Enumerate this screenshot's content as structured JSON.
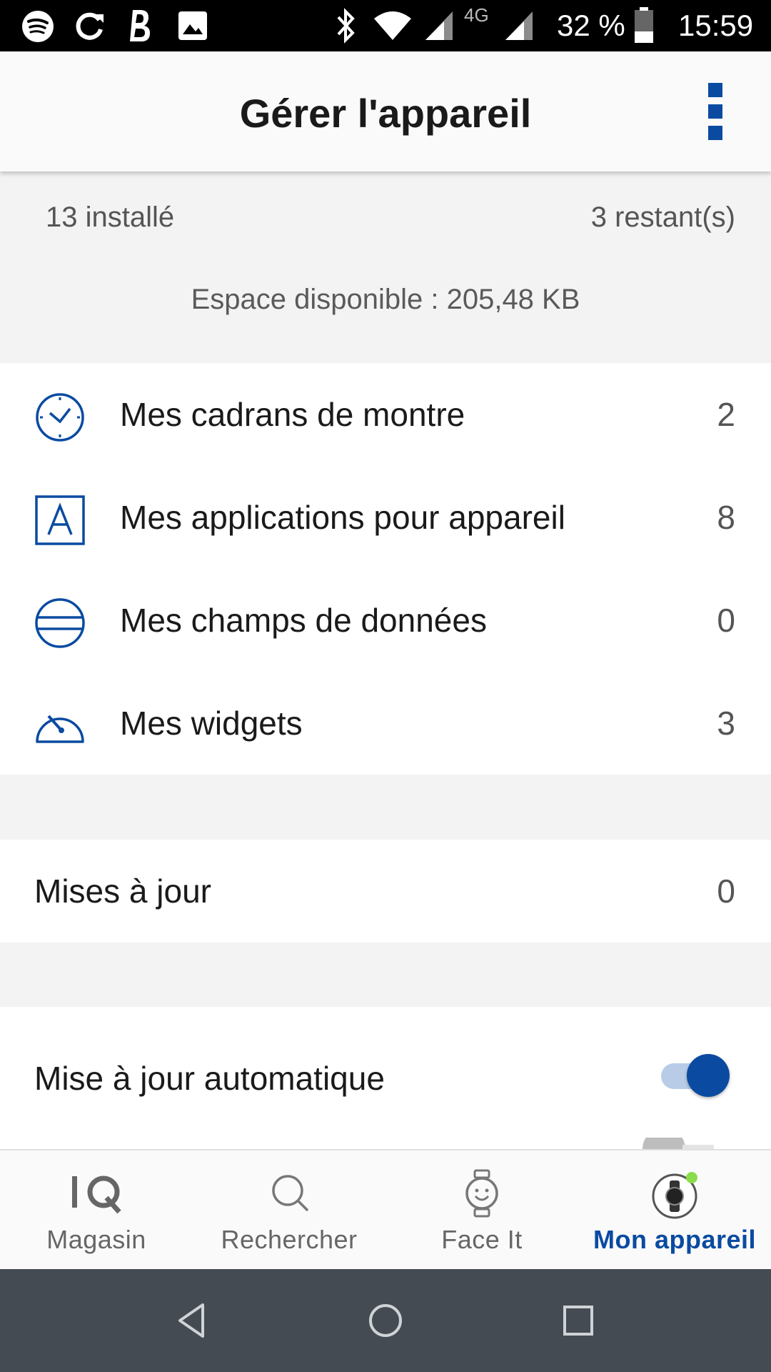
{
  "status_bar": {
    "battery_percent": "32 %",
    "time": "15:59",
    "network_label": "4G"
  },
  "header": {
    "title": "Gérer l'appareil"
  },
  "summary": {
    "installed": "13 installé",
    "remaining": "3 restant(s)",
    "space": "Espace disponible : 205,48 KB"
  },
  "categories": [
    {
      "label": "Mes cadrans de montre",
      "count": "2",
      "icon": "watch-face-icon"
    },
    {
      "label": "Mes applications pour appareil",
      "count": "8",
      "icon": "app-icon"
    },
    {
      "label": "Mes champs de données",
      "count": "0",
      "icon": "data-field-icon"
    },
    {
      "label": "Mes widgets",
      "count": "3",
      "icon": "widget-gauge-icon"
    }
  ],
  "updates": {
    "label": "Mises à jour",
    "count": "0"
  },
  "auto_update": {
    "label": "Mise à jour automatique",
    "enabled": true
  },
  "bottom_nav": [
    {
      "label": "Magasin",
      "icon": "iq-store-icon",
      "active": false
    },
    {
      "label": "Rechercher",
      "icon": "search-icon",
      "active": false
    },
    {
      "label": "Face It",
      "icon": "face-it-watch-icon",
      "active": false
    },
    {
      "label": "Mon appareil",
      "icon": "device-watch-icon",
      "active": true
    }
  ],
  "colors": {
    "accent": "#0a4ba1",
    "status_dot": "#8bdc4a"
  }
}
